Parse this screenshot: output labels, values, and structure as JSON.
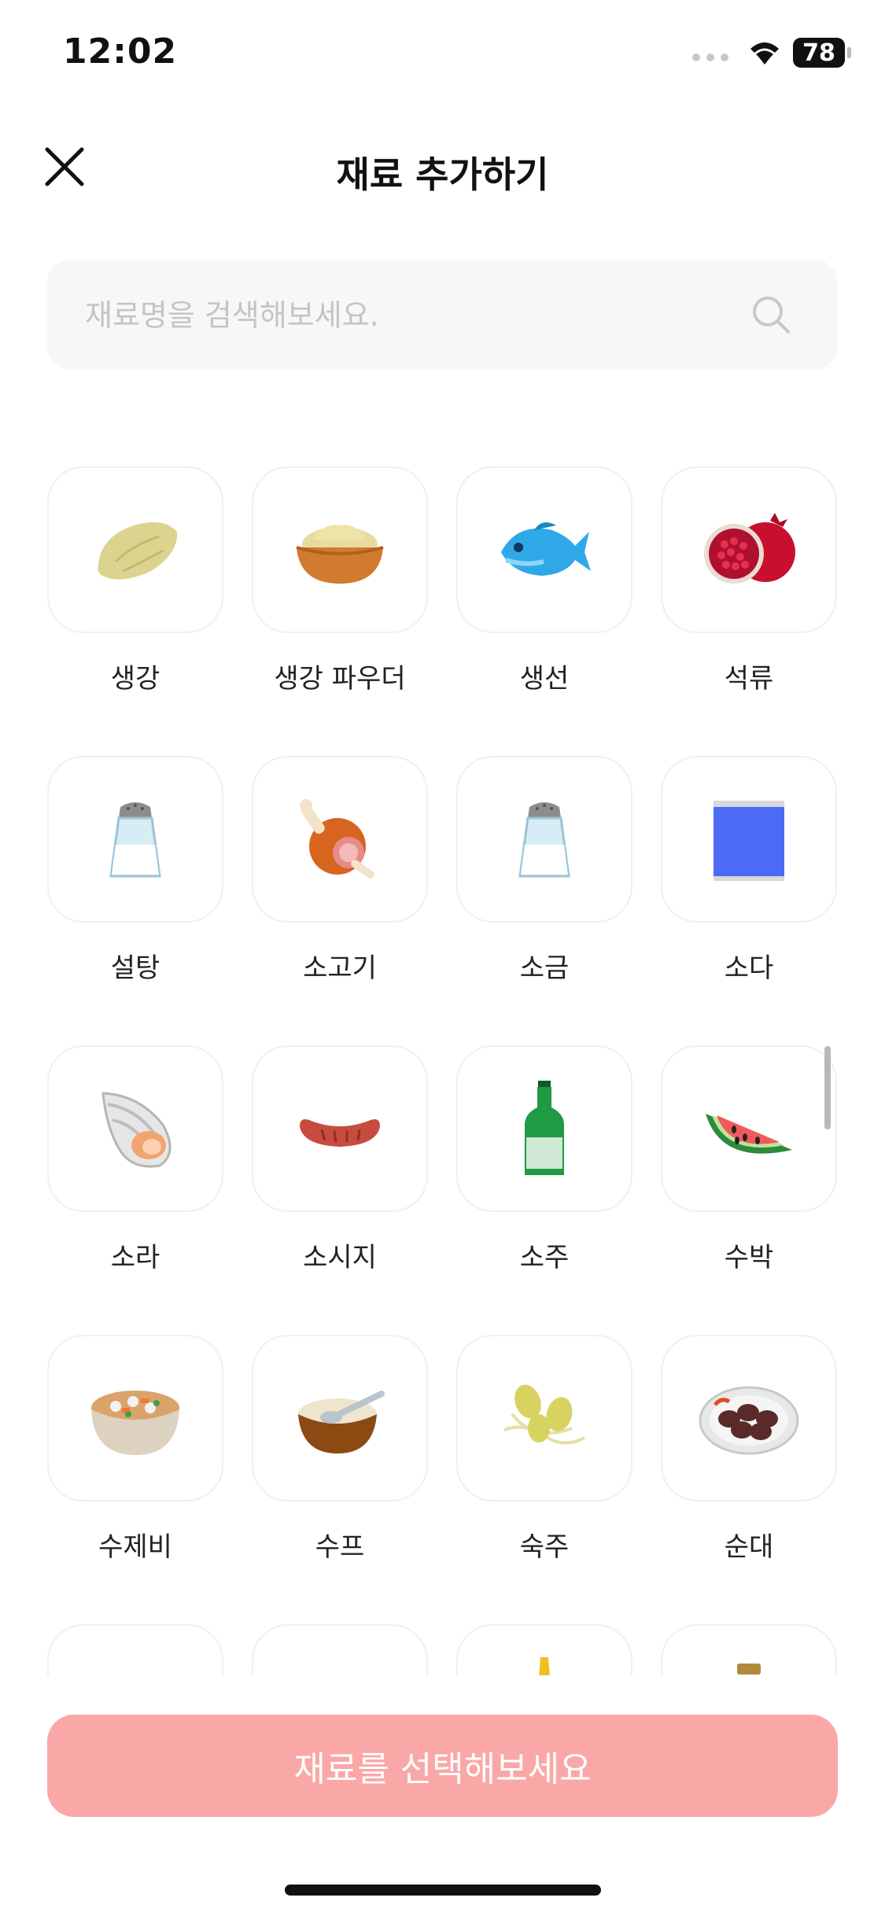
{
  "status_bar": {
    "time": "12:02",
    "battery": "78"
  },
  "header": {
    "title": "재료 추가하기"
  },
  "search": {
    "placeholder": "재료명을 검색해보세요."
  },
  "grid": {
    "items": [
      {
        "label": "생강",
        "icon": "ginger-icon"
      },
      {
        "label": "생강 파우더",
        "icon": "ginger-powder-icon"
      },
      {
        "label": "생선",
        "icon": "fish-icon"
      },
      {
        "label": "석류",
        "icon": "pomegranate-icon"
      },
      {
        "label": "설탕",
        "icon": "sugar-shaker-icon"
      },
      {
        "label": "소고기",
        "icon": "beef-icon"
      },
      {
        "label": "소금",
        "icon": "salt-shaker-icon"
      },
      {
        "label": "소다",
        "icon": "soda-can-icon"
      },
      {
        "label": "소라",
        "icon": "conch-icon"
      },
      {
        "label": "소시지",
        "icon": "sausage-icon"
      },
      {
        "label": "소주",
        "icon": "soju-bottle-icon"
      },
      {
        "label": "수박",
        "icon": "watermelon-icon"
      },
      {
        "label": "수제비",
        "icon": "sujebi-bowl-icon"
      },
      {
        "label": "수프",
        "icon": "soup-bowl-icon"
      },
      {
        "label": "숙주",
        "icon": "bean-sprouts-icon"
      },
      {
        "label": "순대",
        "icon": "sundae-plate-icon"
      }
    ]
  },
  "bottom_button": {
    "label": "재료를 선택해보세요"
  },
  "colors": {
    "accent": "#f9a8a7",
    "search_bg": "#f7f7f7",
    "tile_border": "#f0f0f0"
  }
}
